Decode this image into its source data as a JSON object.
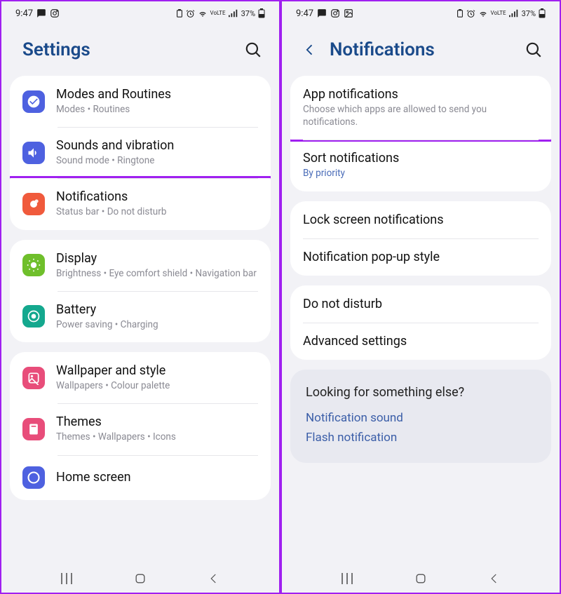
{
  "status": {
    "time": "9:47",
    "battery": "37%",
    "volte": "VoLTE"
  },
  "left": {
    "title": "Settings",
    "cards": [
      {
        "rows": [
          {
            "icon": "modes",
            "color": "#4e61e0",
            "title": "Modes and Routines",
            "sub": "Modes  •  Routines"
          },
          {
            "icon": "sound",
            "color": "#4e61e0",
            "title": "Sounds and vibration",
            "sub": "Sound mode  •  Ringtone"
          },
          {
            "icon": "notif",
            "color": "#f05a3c",
            "title": "Notifications",
            "sub": "Status bar  •  Do not disturb",
            "highlight": true
          }
        ]
      },
      {
        "rows": [
          {
            "icon": "display",
            "color": "#6fbf2b",
            "title": "Display",
            "sub": "Brightness  •  Eye comfort shield  •  Navigation bar"
          },
          {
            "icon": "battery",
            "color": "#14a88e",
            "title": "Battery",
            "sub": "Power saving  •  Charging"
          }
        ]
      },
      {
        "rows": [
          {
            "icon": "wallpaper",
            "color": "#e84d7a",
            "title": "Wallpaper and style",
            "sub": "Wallpapers  •  Colour palette"
          },
          {
            "icon": "themes",
            "color": "#e84d7a",
            "title": "Themes",
            "sub": "Themes  •  Wallpapers  •  Icons"
          },
          {
            "icon": "home",
            "color": "#4e61e0",
            "title": "Home screen",
            "sub": ""
          }
        ]
      }
    ]
  },
  "right": {
    "title": "Notifications",
    "cards": [
      {
        "rows": [
          {
            "title": "App notifications",
            "sub": "Choose which apps are allowed to send you notifications.",
            "highlight": true
          },
          {
            "title": "Sort notifications",
            "sub": "By priority",
            "subStyle": "blue"
          }
        ]
      },
      {
        "rows": [
          {
            "title": "Lock screen notifications"
          },
          {
            "title": "Notification pop-up style"
          }
        ]
      },
      {
        "rows": [
          {
            "title": "Do not disturb"
          },
          {
            "title": "Advanced settings"
          }
        ]
      }
    ],
    "looking": {
      "title": "Looking for something else?",
      "links": [
        "Notification sound",
        "Flash notification"
      ]
    }
  }
}
